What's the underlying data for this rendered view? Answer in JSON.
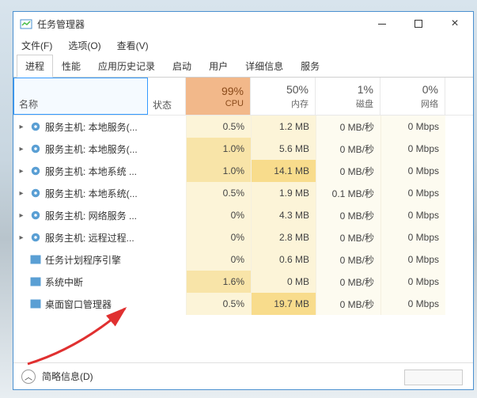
{
  "window": {
    "title": "任务管理器"
  },
  "menu": {
    "file": "文件(F)",
    "options": "选项(O)",
    "view": "查看(V)"
  },
  "tabs": [
    "进程",
    "性能",
    "应用历史记录",
    "启动",
    "用户",
    "详细信息",
    "服务"
  ],
  "columns": {
    "name": "名称",
    "status": "状态",
    "cpu": {
      "pct": "99%",
      "label": "CPU"
    },
    "mem": {
      "pct": "50%",
      "label": "内存"
    },
    "disk": {
      "pct": "1%",
      "label": "磁盘"
    },
    "net": {
      "pct": "0%",
      "label": "网络"
    }
  },
  "processes": [
    {
      "icon": "gear",
      "expand": "▸",
      "name": "服务主机: 本地服务(...",
      "cpu": "0.5%",
      "mem": "1.2 MB",
      "disk": "0 MB/秒",
      "net": "0 Mbps",
      "cpuHi": false,
      "memHi": false
    },
    {
      "icon": "gear",
      "expand": "▸",
      "name": "服务主机: 本地服务(...",
      "cpu": "1.0%",
      "mem": "5.6 MB",
      "disk": "0 MB/秒",
      "net": "0 Mbps",
      "cpuHi": true,
      "memHi": false
    },
    {
      "icon": "gear",
      "expand": "▸",
      "name": "服务主机: 本地系统 ...",
      "cpu": "1.0%",
      "mem": "14.1 MB",
      "disk": "0 MB/秒",
      "net": "0 Mbps",
      "cpuHi": true,
      "memHi": true
    },
    {
      "icon": "gear",
      "expand": "▸",
      "name": "服务主机: 本地系统(...",
      "cpu": "0.5%",
      "mem": "1.9 MB",
      "disk": "0.1 MB/秒",
      "net": "0 Mbps",
      "cpuHi": false,
      "memHi": false
    },
    {
      "icon": "gear",
      "expand": "▸",
      "name": "服务主机: 网络服务 ...",
      "cpu": "0%",
      "mem": "4.3 MB",
      "disk": "0 MB/秒",
      "net": "0 Mbps",
      "cpuHi": false,
      "memHi": false
    },
    {
      "icon": "gear",
      "expand": "▸",
      "name": "服务主机: 远程过程...",
      "cpu": "0%",
      "mem": "2.8 MB",
      "disk": "0 MB/秒",
      "net": "0 Mbps",
      "cpuHi": false,
      "memHi": false
    },
    {
      "icon": "win",
      "expand": "",
      "name": "任务计划程序引擎",
      "cpu": "0%",
      "mem": "0.6 MB",
      "disk": "0 MB/秒",
      "net": "0 Mbps",
      "cpuHi": false,
      "memHi": false
    },
    {
      "icon": "win",
      "expand": "",
      "name": "系统中断",
      "cpu": "1.6%",
      "mem": "0 MB",
      "disk": "0 MB/秒",
      "net": "0 Mbps",
      "cpuHi": true,
      "memHi": false
    },
    {
      "icon": "win",
      "expand": "",
      "name": "桌面窗口管理器",
      "cpu": "0.5%",
      "mem": "19.7 MB",
      "disk": "0 MB/秒",
      "net": "0 Mbps",
      "cpuHi": false,
      "memHi": true
    }
  ],
  "footer": {
    "label": "简略信息(D)"
  }
}
